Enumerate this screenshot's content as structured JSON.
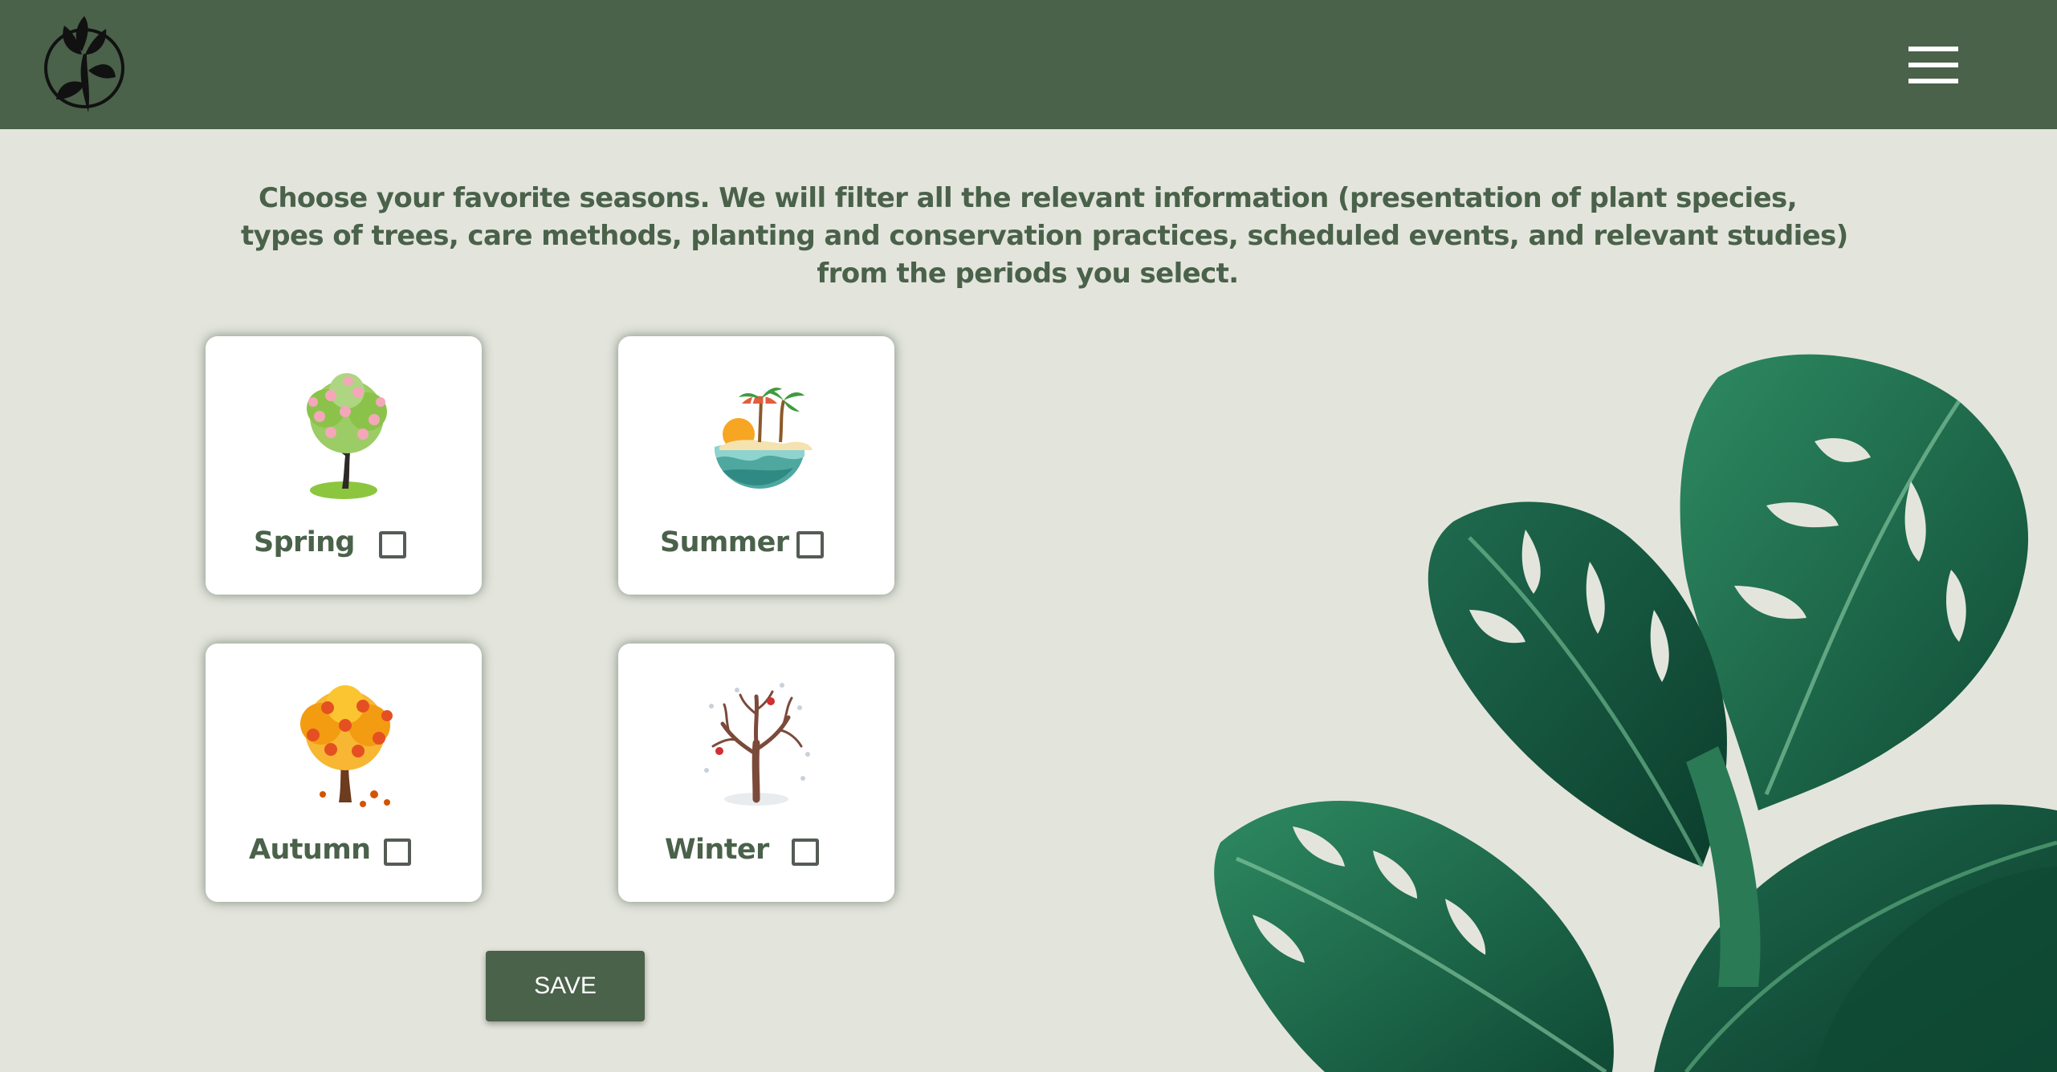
{
  "header": {
    "logo_icon": "lily-flower-logo",
    "menu_icon": "hamburger-menu-icon",
    "background_color": "#4a614a"
  },
  "intro": {
    "line1": "Choose your favorite seasons. We will filter all the relevant information (presentation of plant species,",
    "line2": "types of trees, care methods, planting and conservation practices, scheduled events, and relevant studies)",
    "line3": "from the periods you select."
  },
  "seasons": [
    {
      "label": "Spring",
      "icon": "spring-blossom-tree-icon",
      "checked": false
    },
    {
      "label": "Summer",
      "icon": "summer-beach-island-icon",
      "checked": false
    },
    {
      "label": "Autumn",
      "icon": "autumn-tree-icon",
      "checked": false
    },
    {
      "label": "Winter",
      "icon": "winter-bare-tree-icon",
      "checked": false
    }
  ],
  "actions": {
    "save_label": "SAVE"
  },
  "decoration": {
    "image": "monstera-leaves-image"
  },
  "colors": {
    "primary": "#4a614a",
    "page_background": "#e3e5dd",
    "card_background": "#ffffff",
    "leaf_green": "#1f6b4f"
  }
}
